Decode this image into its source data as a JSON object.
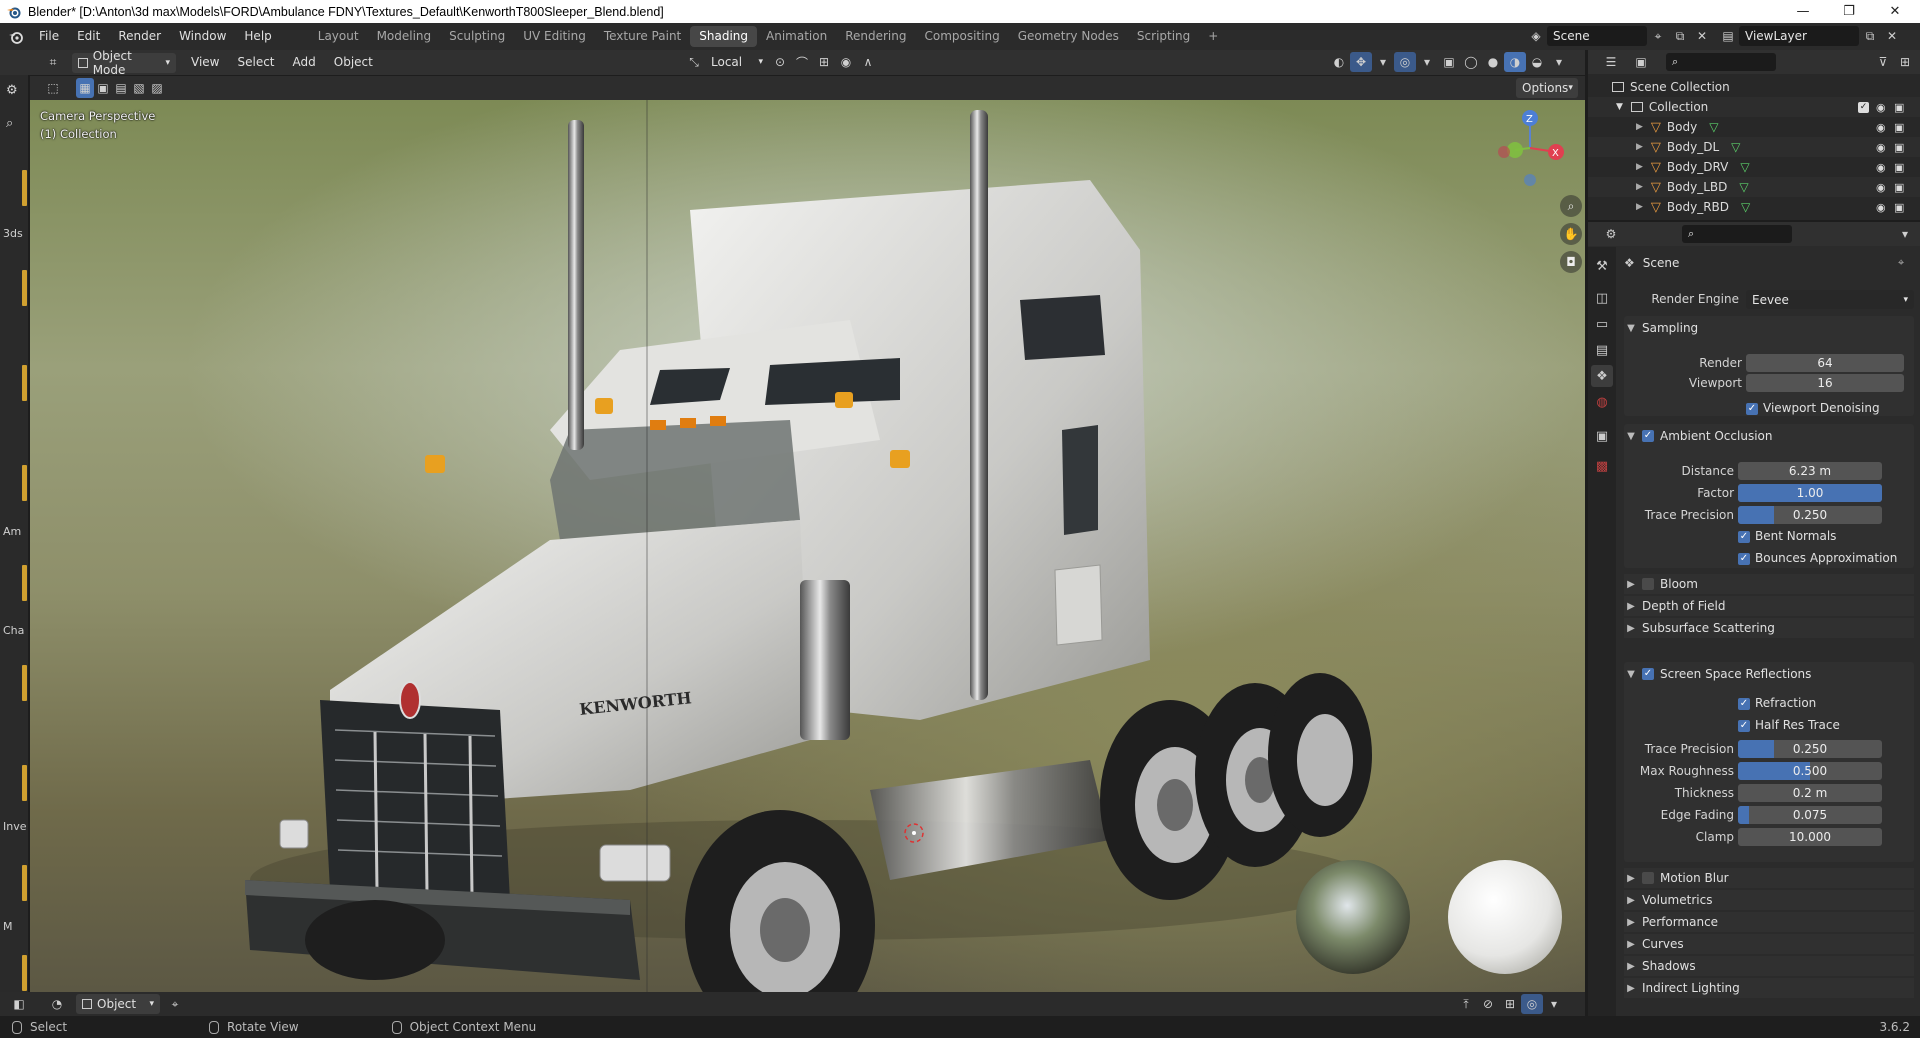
{
  "window": {
    "title": "Blender* [D:\\Anton\\3d max\\Models\\FORD\\Ambulance FDNY\\Textures_Default\\KenworthT800Sleeper_Blend.blend]",
    "minimize": "—",
    "maximize": "❐",
    "close": "✕"
  },
  "menu": [
    "File",
    "Edit",
    "Render",
    "Window",
    "Help"
  ],
  "workspaces": [
    "Layout",
    "Modeling",
    "Sculpting",
    "UV Editing",
    "Texture Paint",
    "Shading",
    "Animation",
    "Rendering",
    "Compositing",
    "Geometry Nodes",
    "Scripting"
  ],
  "active_workspace": "Shading",
  "add_workspace": "+",
  "scene": {
    "name": "Scene",
    "view_layer": "ViewLayer"
  },
  "viewport_header": {
    "mode": "Object Mode",
    "menus": [
      "View",
      "Select",
      "Add",
      "Object"
    ],
    "transform_orientation": "Local",
    "options_label": "Options"
  },
  "viewport": {
    "camera_label": "Camera Perspective",
    "collection_label": "(1) Collection",
    "grille_brand": "KENWORTH",
    "gizmo_axes": {
      "z": "Z",
      "x": "X"
    }
  },
  "left_toolbar_tags": [
    "3ds",
    "Am",
    "Cha",
    "Inve",
    "M"
  ],
  "outliner": {
    "root": "Scene Collection",
    "collection": "Collection",
    "objects": [
      "Body",
      "Body_DL",
      "Body_DRV",
      "Body_LBD",
      "Body_RBD"
    ]
  },
  "properties": {
    "context": "Scene",
    "render_engine_label": "Render Engine",
    "render_engine": "Eevee",
    "sampling": {
      "title": "Sampling",
      "render_label": "Render",
      "render": "64",
      "viewport_label": "Viewport",
      "viewport": "16",
      "denoise_label": "Viewport Denoising"
    },
    "ao": {
      "title": "Ambient Occlusion",
      "distance_label": "Distance",
      "distance": "6.23 m",
      "factor_label": "Factor",
      "factor": "1.00",
      "factor_fill": 1.0,
      "trace_label": "Trace Precision",
      "trace": "0.250",
      "trace_fill": 0.25,
      "bent_label": "Bent Normals",
      "bounces_label": "Bounces Approximation"
    },
    "collapsed_a": [
      "Bloom",
      "Depth of Field",
      "Subsurface Scattering"
    ],
    "ssr": {
      "title": "Screen Space Reflections",
      "refraction_label": "Refraction",
      "halfres_label": "Half Res Trace",
      "trace_label": "Trace Precision",
      "trace": "0.250",
      "trace_fill": 0.25,
      "rough_label": "Max Roughness",
      "rough": "0.500",
      "rough_fill": 0.5,
      "thick_label": "Thickness",
      "thick": "0.2 m",
      "fade_label": "Edge Fading",
      "fade": "0.075",
      "fade_fill": 0.075,
      "clamp_label": "Clamp",
      "clamp": "10.000"
    },
    "collapsed_b": [
      "Motion Blur",
      "Volumetrics",
      "Performance",
      "Curves",
      "Shadows",
      "Indirect Lighting"
    ]
  },
  "footer": {
    "mode": "Object"
  },
  "status": {
    "select": "Select",
    "rotate": "Rotate View",
    "context_menu": "Object Context Menu",
    "version": "3.6.2"
  },
  "colors": {
    "accent": "#4772b3",
    "active_tab": "#474747",
    "panel": "#303030",
    "background": "#1d1d1d"
  }
}
